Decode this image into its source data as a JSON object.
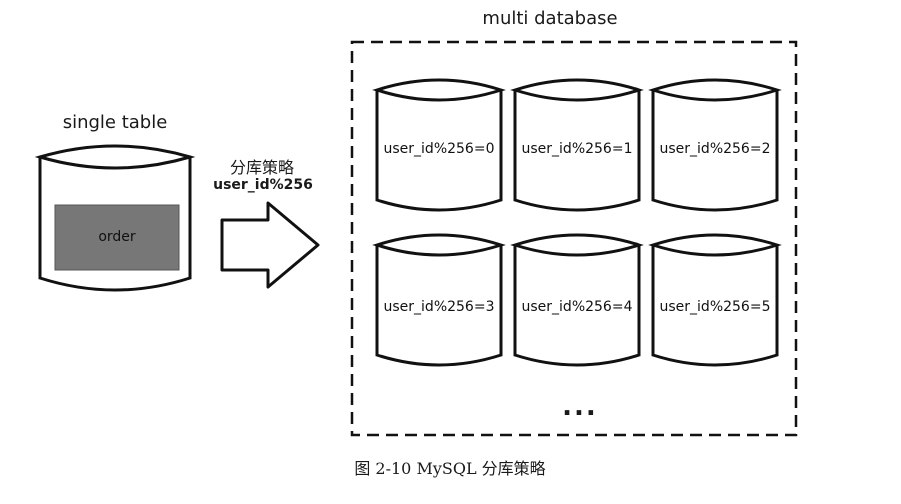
{
  "single": {
    "title": "single table",
    "table": "order"
  },
  "strategy": {
    "title": "分库策略",
    "expression": "user_id%256"
  },
  "multi": {
    "title": "multi database",
    "databases": [
      "user_id%256=0",
      "user_id%256=1",
      "user_id%256=2",
      "user_id%256=3",
      "user_id%256=4",
      "user_id%256=5"
    ],
    "ellipsis": "..."
  },
  "caption": "图 2-10   MySQL 分库策略",
  "colors": {
    "stroke": "#111111",
    "order_fill": "#777777",
    "cylinder_fill": "#ffffff"
  }
}
